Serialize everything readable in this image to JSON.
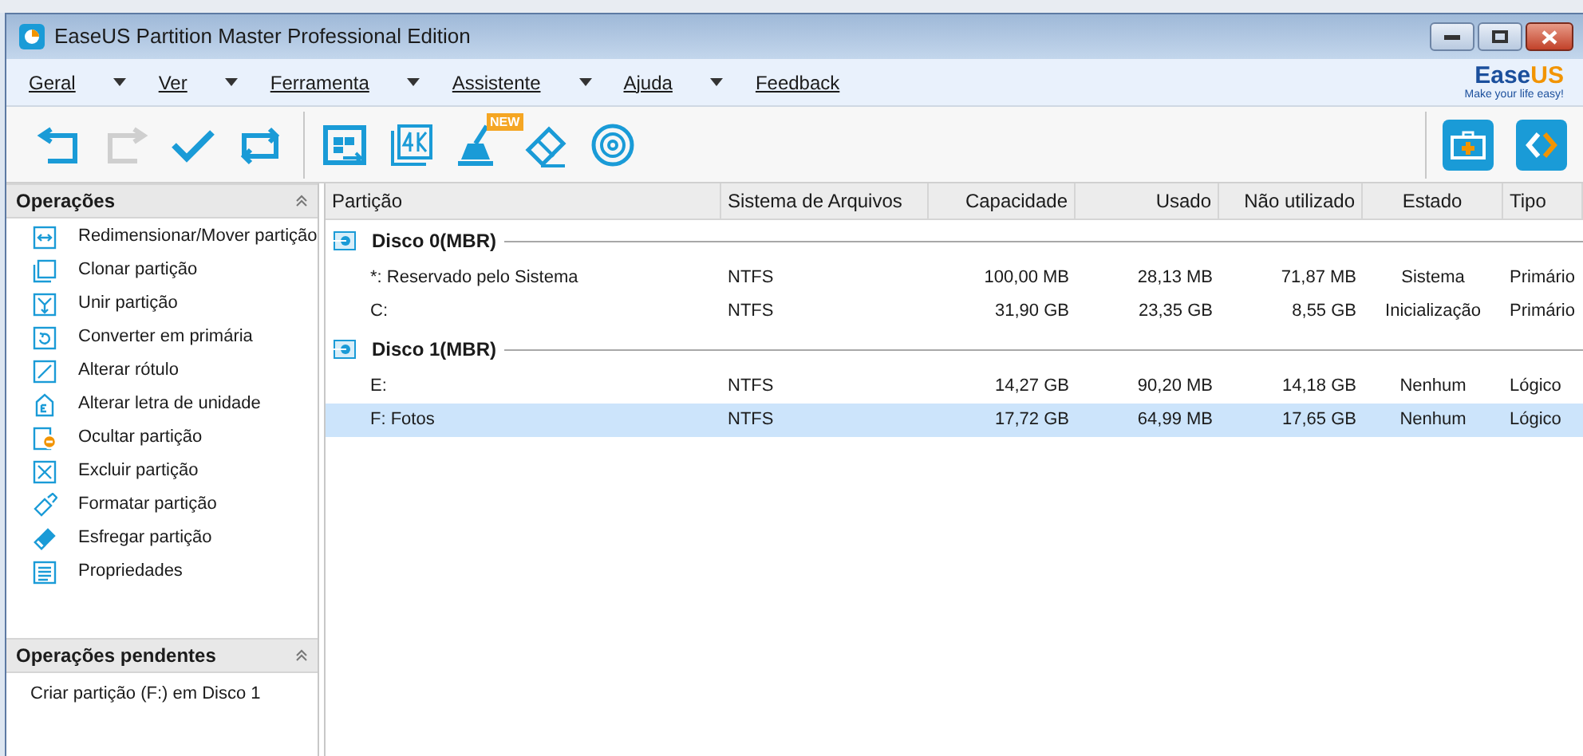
{
  "window": {
    "title": "EaseUS Partition Master Professional Edition"
  },
  "menu": [
    {
      "label": "Geral",
      "dropdown": true
    },
    {
      "label": "Ver",
      "dropdown": true
    },
    {
      "label": "Ferramenta",
      "dropdown": true
    },
    {
      "label": "Assistente",
      "dropdown": true
    },
    {
      "label": "Ajuda",
      "dropdown": true
    },
    {
      "label": "Feedback",
      "dropdown": false
    }
  ],
  "logo": {
    "name_start": "Ease",
    "name_end": "US",
    "tagline": "Make your life easy!"
  },
  "toolbar": [
    {
      "kind": "undo",
      "disabled": false
    },
    {
      "kind": "redo",
      "disabled": true
    },
    {
      "kind": "apply",
      "disabled": false
    },
    {
      "kind": "refresh",
      "disabled": false
    },
    {
      "kind": "migrate",
      "disabled": false
    },
    {
      "kind": "align4k",
      "disabled": false
    },
    {
      "kind": "cleanup",
      "disabled": false,
      "badge": "NEW"
    },
    {
      "kind": "wipe",
      "disabled": false
    },
    {
      "kind": "disc",
      "disabled": false
    }
  ],
  "operations": {
    "title": "Operações",
    "items": [
      {
        "kind": "resize",
        "label": "Redimensionar/Mover partição"
      },
      {
        "kind": "clone",
        "label": "Clonar partição"
      },
      {
        "kind": "merge",
        "label": "Unir partição"
      },
      {
        "kind": "convert",
        "label": "Converter em primária"
      },
      {
        "kind": "label",
        "label": "Alterar rótulo"
      },
      {
        "kind": "letter",
        "label": "Alterar letra de unidade"
      },
      {
        "kind": "hide",
        "label": "Ocultar partição"
      },
      {
        "kind": "delete",
        "label": "Excluir partição"
      },
      {
        "kind": "format",
        "label": "Formatar partição"
      },
      {
        "kind": "wipe",
        "label": "Esfregar partição"
      },
      {
        "kind": "props",
        "label": "Propriedades"
      }
    ]
  },
  "pending": {
    "title": "Operações pendentes",
    "items": [
      "Criar partição (F:) em Disco 1"
    ]
  },
  "table": {
    "columns": [
      "Partição",
      "Sistema de Arquivos",
      "Capacidade",
      "Usado",
      "Não utilizado",
      "Estado",
      "Tipo"
    ],
    "disks": [
      {
        "name": "Disco 0(MBR)",
        "rows": [
          {
            "cells": [
              "*: Reservado pelo Sistema",
              "NTFS",
              "100,00 MB",
              "28,13 MB",
              "71,87 MB",
              "Sistema",
              "Primário"
            ],
            "selected": false
          },
          {
            "cells": [
              "C:",
              "NTFS",
              "31,90 GB",
              "23,35 GB",
              "8,55 GB",
              "Inicialização",
              "Primário"
            ],
            "selected": false
          }
        ]
      },
      {
        "name": "Disco 1(MBR)",
        "rows": [
          {
            "cells": [
              "E:",
              "NTFS",
              "14,27 GB",
              "90,20 MB",
              "14,18 GB",
              "Nenhum",
              "Lógico"
            ],
            "selected": false
          },
          {
            "cells": [
              "F: Fotos",
              "NTFS",
              "17,72 GB",
              "64,99 MB",
              "17,65 GB",
              "Nenhum",
              "Lógico"
            ],
            "selected": true
          }
        ]
      }
    ]
  }
}
